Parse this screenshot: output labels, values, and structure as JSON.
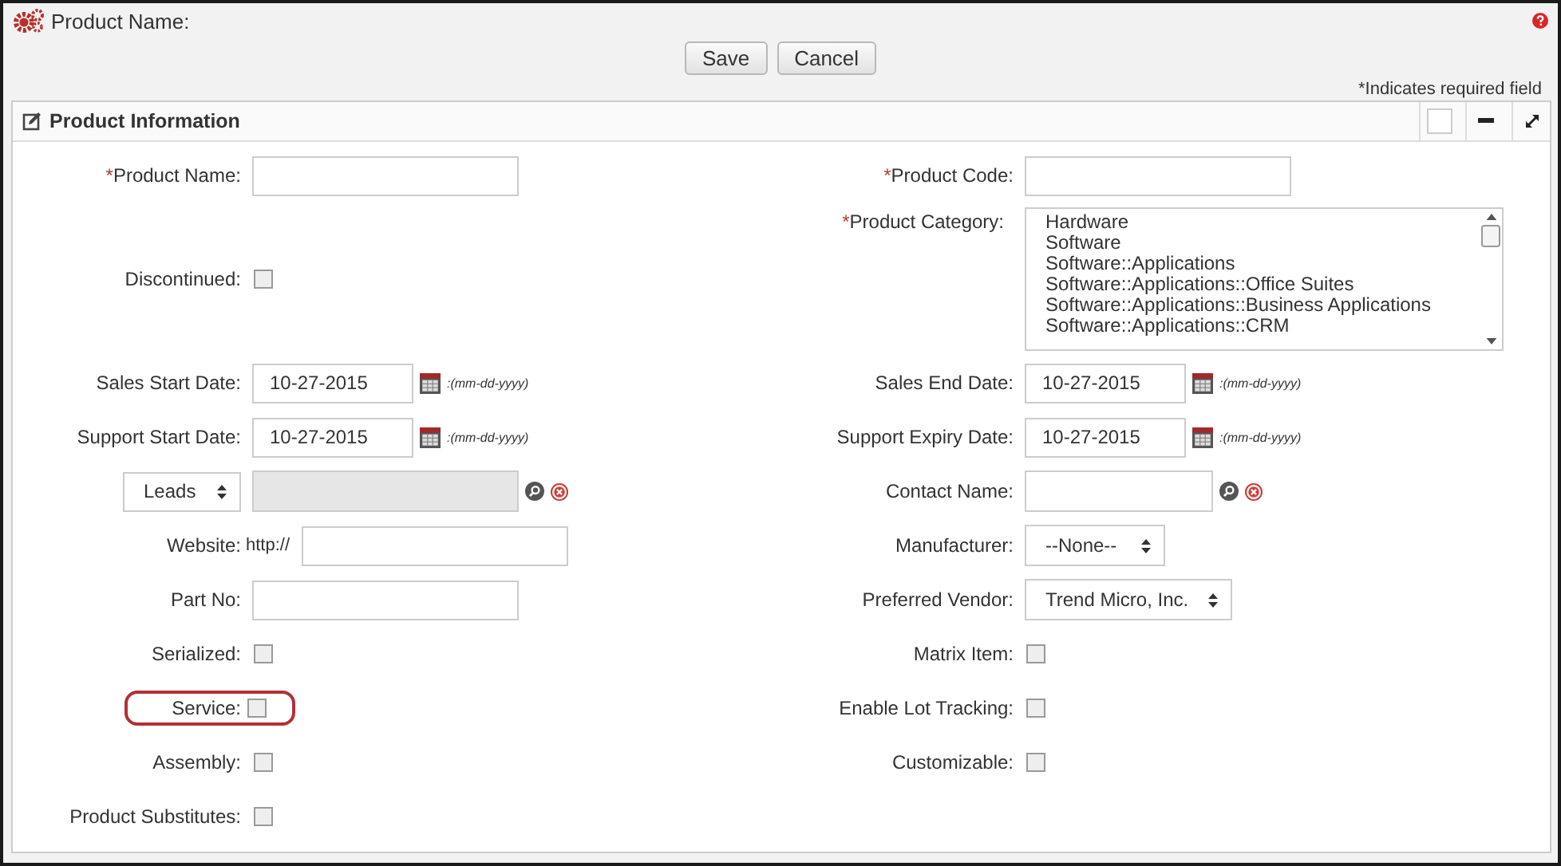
{
  "header": {
    "title": "Product Name:"
  },
  "buttons": [
    "Save",
    "Cancel"
  ],
  "required_note": "*Indicates required field",
  "panel": {
    "title": "Product Information"
  },
  "rows": [
    {
      "left": {
        "kind": "text",
        "label": "Product Name:",
        "required_mark": "*"
      },
      "right": {
        "kind": "text",
        "label": "Product Code:",
        "required_mark": "*"
      }
    },
    {
      "left": {
        "kind": "checkbox",
        "label": "Discontinued:",
        "checked": false
      },
      "right": {
        "kind": "listbox",
        "label": "Product Category:",
        "required_mark": "*",
        "options": [
          {
            "label": "Hardware",
            "selected": false
          },
          {
            "label": "Software",
            "selected": false
          },
          {
            "label": "Software::Applications",
            "selected": false
          },
          {
            "label": "Software::Applications::Office Suites",
            "selected": false
          },
          {
            "label": "Software::Applications::Business Applications",
            "selected": false
          },
          {
            "label": "Software::Applications::CRM",
            "selected": false
          }
        ]
      }
    },
    {
      "left": {
        "kind": "date",
        "label": "Sales Start Date:",
        "value": "10-27-2015",
        "hint": ":(mm-dd-yyyy)"
      },
      "right": {
        "kind": "date",
        "label": "Sales End Date:",
        "value": "10-27-2015",
        "hint": ":(mm-dd-yyyy)"
      }
    },
    {
      "left": {
        "kind": "date",
        "label": "Support Start Date:",
        "value": "10-27-2015",
        "hint": ":(mm-dd-yyyy)"
      },
      "right": {
        "kind": "date",
        "label": "Support Expiry Date:",
        "value": "10-27-2015",
        "hint": ":(mm-dd-yyyy)"
      }
    },
    {
      "left": {
        "kind": "typed_lookup",
        "type_value": "Leads",
        "disabled": true
      },
      "right": {
        "kind": "lookup",
        "label": "Contact Name:",
        "disabled": false
      }
    },
    {
      "left": {
        "kind": "url",
        "label": "Website:",
        "prefix": "http://"
      },
      "right": {
        "kind": "select",
        "label": "Manufacturer:",
        "value": "--None--"
      }
    },
    {
      "left": {
        "kind": "text",
        "label": "Part No:"
      },
      "right": {
        "kind": "select",
        "label": "Preferred Vendor:",
        "value": "Trend Micro, Inc."
      }
    },
    {
      "left": {
        "kind": "checkbox",
        "label": "Serialized:",
        "checked": false
      },
      "right": {
        "kind": "checkbox",
        "label": "Matrix Item:",
        "checked": false
      }
    },
    {
      "left": {
        "kind": "checkbox",
        "label": "Service:",
        "checked": false,
        "highlighted": true
      },
      "right": {
        "kind": "checkbox",
        "label": "Enable Lot Tracking:",
        "checked": false
      }
    },
    {
      "left": {
        "kind": "checkbox",
        "label": "Assembly:",
        "checked": false
      },
      "right": {
        "kind": "checkbox",
        "label": "Customizable:",
        "checked": false
      }
    },
    {
      "left": {
        "kind": "checkbox",
        "label": "Product Substitutes:",
        "checked": false
      }
    }
  ]
}
